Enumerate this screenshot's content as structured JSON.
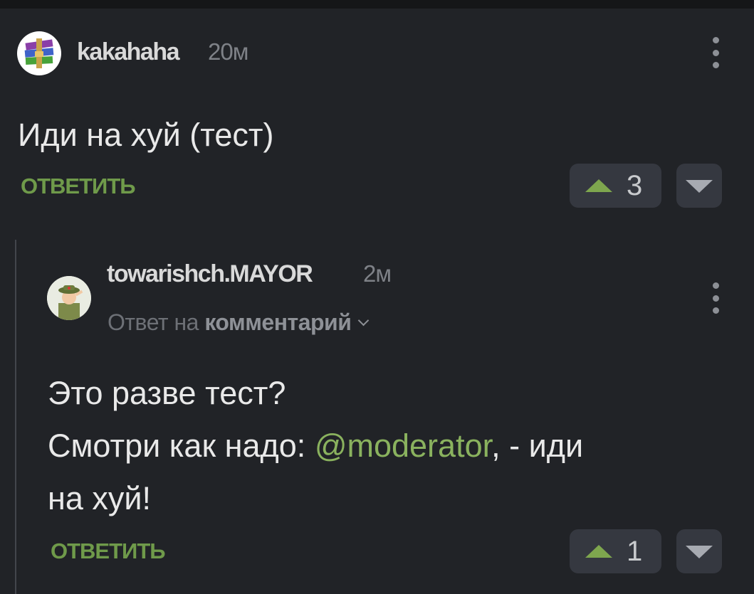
{
  "comments": [
    {
      "username": "kakahaha",
      "time": "20м",
      "text_lines": [
        "Иди на хуй (тест)"
      ],
      "reply_label": "ОТВЕТИТЬ",
      "upvotes": "3",
      "avatar_icon": "winrar-books-icon"
    },
    {
      "username": "towarishch.MAYOR",
      "time": "2м",
      "reply_to_prefix": "Ответ на",
      "reply_to_target": "комментарий",
      "line1": "Это разве тест?",
      "line2_before": "Смотри как надо: ",
      "mention": "@moderator",
      "line2_after": ", - иди",
      "line3": "на хуй!",
      "reply_label": "ОТВЕТИТЬ",
      "upvotes": "1",
      "avatar_icon": "soldier-saluting-icon"
    }
  ],
  "colors": {
    "background": "#212327",
    "accent_green": "#6f9a4a",
    "mention_green": "#8ab25e",
    "vote_button": "#353840"
  }
}
